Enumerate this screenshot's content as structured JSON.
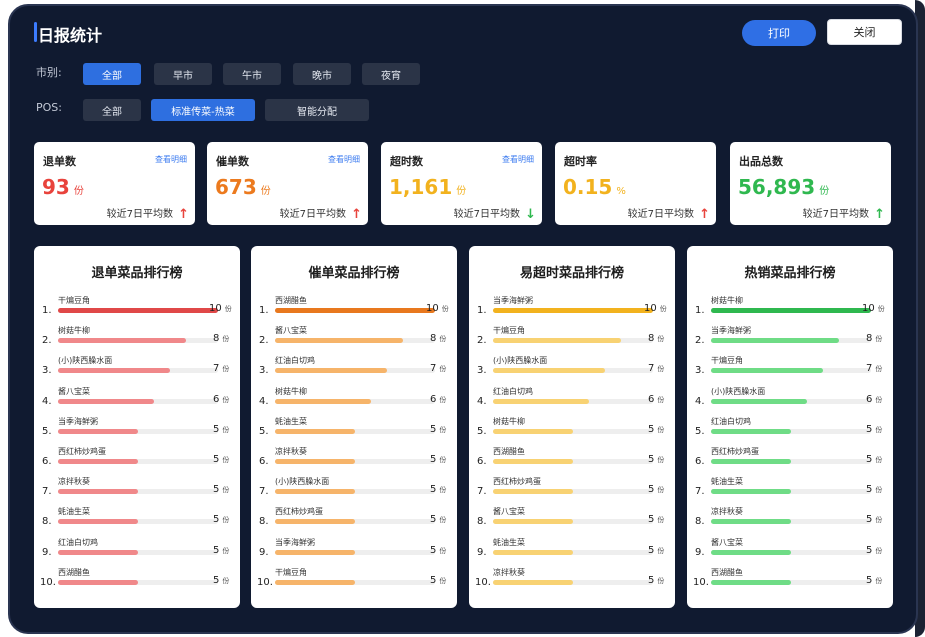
{
  "header": {
    "title": "日报统计",
    "print_label": "打印",
    "close_label": "关闭"
  },
  "filters": {
    "city_label": "市别:",
    "city_options": [
      "全部",
      "早市",
      "午市",
      "晚市",
      "夜宵"
    ],
    "city_active": 0,
    "pos_label": "POS:",
    "pos_options": [
      "全部",
      "标准传菜-热菜",
      "智能分配"
    ],
    "pos_active": 1
  },
  "stats": [
    {
      "title": "退单数",
      "detail": "查看明细",
      "value": "93",
      "unit": "份",
      "compare": "较近7日平均数",
      "trend": "up",
      "color": "#e8433c",
      "arrow_color": "#e8433c"
    },
    {
      "title": "催单数",
      "detail": "查看明细",
      "value": "673",
      "unit": "份",
      "compare": "较近7日平均数",
      "trend": "up",
      "color": "#ec7a1e",
      "arrow_color": "#e8433c"
    },
    {
      "title": "超时数",
      "detail": "查看明细",
      "value": "1,161",
      "unit": "份",
      "compare": "较近7日平均数",
      "trend": "down",
      "color": "#f2b21e",
      "arrow_color": "#2fb84f"
    },
    {
      "title": "超时率",
      "detail": "",
      "value": "0.15",
      "unit": "%",
      "compare": "较近7日平均数",
      "trend": "up",
      "color": "#f2b21e",
      "arrow_color": "#e8433c"
    },
    {
      "title": "出品总数",
      "detail": "",
      "value": "56,893",
      "unit": "份",
      "compare": "较近7日平均数",
      "trend": "up",
      "color": "#2fb84f",
      "arrow_color": "#2fb84f"
    }
  ],
  "rankings": [
    {
      "title": "退单菜品排行榜",
      "color_top": "#e04848",
      "color": "#f0888a",
      "max": 10,
      "unit": "份",
      "items": [
        {
          "name": "干煸豆角",
          "value": 10
        },
        {
          "name": "树菇牛柳",
          "value": 8
        },
        {
          "name": "(小)陕西臊水面",
          "value": 7
        },
        {
          "name": "酱八宝菜",
          "value": 6
        },
        {
          "name": "当季海鲜粥",
          "value": 5
        },
        {
          "name": "西红柿炒鸡蛋",
          "value": 5
        },
        {
          "name": "凉拌秋葵",
          "value": 5
        },
        {
          "name": "蚝油生菜",
          "value": 5
        },
        {
          "name": "红油白切鸡",
          "value": 5
        },
        {
          "name": "西湖醋鱼",
          "value": 5
        }
      ]
    },
    {
      "title": "催单菜品排行榜",
      "color_top": "#e8781e",
      "color": "#f6b46a",
      "max": 10,
      "unit": "份",
      "items": [
        {
          "name": "西湖醋鱼",
          "value": 10
        },
        {
          "name": "酱八宝菜",
          "value": 8
        },
        {
          "name": "红油白切鸡",
          "value": 7
        },
        {
          "name": "树菇牛柳",
          "value": 6
        },
        {
          "name": "蚝油生菜",
          "value": 5
        },
        {
          "name": "凉拌秋葵",
          "value": 5
        },
        {
          "name": "(小)陕西臊水面",
          "value": 5
        },
        {
          "name": "西红柿炒鸡蛋",
          "value": 5
        },
        {
          "name": "当季海鲜粥",
          "value": 5
        },
        {
          "name": "干煸豆角",
          "value": 5
        }
      ]
    },
    {
      "title": "易超时菜品排行榜",
      "color_top": "#f2b21e",
      "color": "#f8d273",
      "max": 10,
      "unit": "份",
      "items": [
        {
          "name": "当季海鲜粥",
          "value": 10
        },
        {
          "name": "干煸豆角",
          "value": 8
        },
        {
          "name": "(小)陕西臊水面",
          "value": 7
        },
        {
          "name": "红油白切鸡",
          "value": 6
        },
        {
          "name": "树菇牛柳",
          "value": 5
        },
        {
          "name": "西湖醋鱼",
          "value": 5
        },
        {
          "name": "西红柿炒鸡蛋",
          "value": 5
        },
        {
          "name": "酱八宝菜",
          "value": 5
        },
        {
          "name": "蚝油生菜",
          "value": 5
        },
        {
          "name": "凉拌秋葵",
          "value": 5
        }
      ]
    },
    {
      "title": "热销菜品排行榜",
      "color_top": "#2fb84f",
      "color": "#6fdc86",
      "max": 10,
      "unit": "份",
      "items": [
        {
          "name": "树菇牛柳",
          "value": 10
        },
        {
          "name": "当季海鲜粥",
          "value": 8
        },
        {
          "name": "干煸豆角",
          "value": 7
        },
        {
          "name": "(小)陕西臊水面",
          "value": 6
        },
        {
          "name": "红油白切鸡",
          "value": 5
        },
        {
          "name": "西红柿炒鸡蛋",
          "value": 5
        },
        {
          "name": "蚝油生菜",
          "value": 5
        },
        {
          "name": "凉拌秋葵",
          "value": 5
        },
        {
          "name": "酱八宝菜",
          "value": 5
        },
        {
          "name": "西湖醋鱼",
          "value": 5
        }
      ]
    }
  ]
}
